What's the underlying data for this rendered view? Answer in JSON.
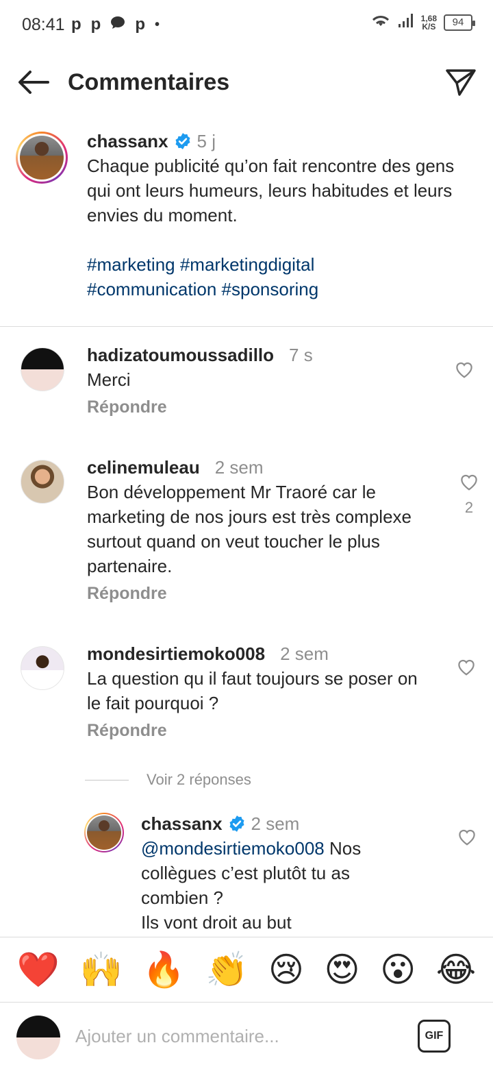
{
  "status_bar": {
    "time": "08:41",
    "app_icons": [
      "p",
      "p",
      "chat-bubble",
      "p"
    ],
    "dot": "•",
    "net_speed_value": "1,68",
    "net_speed_unit": "K/S",
    "battery": "94"
  },
  "header": {
    "title": "Commentaires",
    "back_icon": "arrow-left-icon",
    "share_icon": "paper-plane-icon"
  },
  "caption": {
    "username": "chassanx",
    "verified": true,
    "time": "5 j",
    "text": "Chaque publicité qu’on fait rencontre des gens qui ont leurs humeurs, leurs habitudes et leurs envies du moment.",
    "hashtags_line1": "#marketing #marketingdigital",
    "hashtags_line2": "#communication #sponsoring"
  },
  "comments": [
    {
      "username": "hadizatoumoussadillo",
      "time": "7 s",
      "text": "Merci",
      "reply_label": "Répondre",
      "likes": ""
    },
    {
      "username": "celinemuleau",
      "time": "2 sem",
      "text": "Bon développement Mr Traoré car le marketing de nos jours est très complexe surtout quand on veut toucher le plus partenaire.",
      "reply_label": "Répondre",
      "likes": "2"
    },
    {
      "username": "mondesirtiemoko008",
      "time": "2 sem",
      "text": "La question qu il faut toujours se poser on le fait pourquoi ?",
      "reply_label": "Répondre",
      "likes": ""
    }
  ],
  "view_replies": "Voir 2 réponses",
  "reply": {
    "username": "chassanx",
    "verified": true,
    "time": "2 sem",
    "mention": "@mondesirtiemoko008",
    "text": " Nos collègues c’est plutôt tu as combien ?",
    "text2": "Ils vont droit au but"
  },
  "emoji_bar": [
    "❤️",
    "🙌",
    "🔥",
    "👏",
    "😢",
    "😍",
    "😮",
    "😂"
  ],
  "composer": {
    "placeholder": "Ajouter un commentaire...",
    "gif_label": "GIF"
  },
  "colors": {
    "link": "#00376b",
    "muted": "#8e8e8e",
    "verified": "#1d9bf0",
    "text": "#262626"
  }
}
